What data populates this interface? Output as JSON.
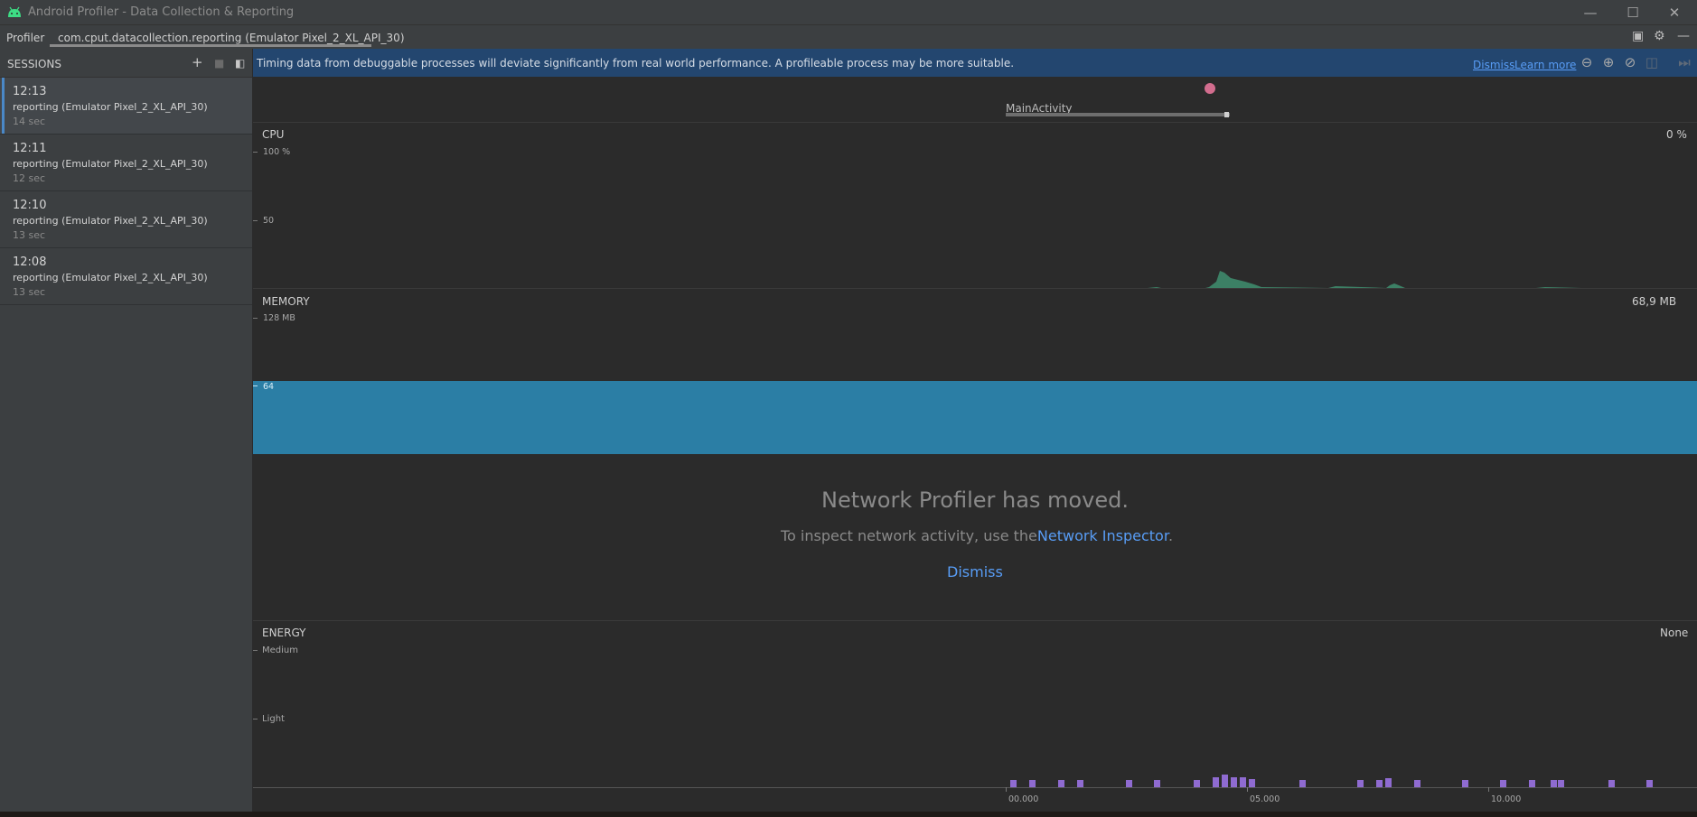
{
  "window": {
    "title": "Android Profiler - Data Collection & Reporting",
    "controls": [
      "—",
      "☐",
      "✕"
    ]
  },
  "tabs": [
    {
      "label": "Profiler"
    },
    {
      "label": "com.cput.datacollection.reporting (Emulator Pixel_2_XL_API_30)"
    }
  ],
  "sessions": {
    "title": "SESSIONS",
    "items": [
      {
        "time": "12:13",
        "name": "reporting (Emulator Pixel_2_XL_API_30)",
        "duration": "14 sec",
        "selected": true
      },
      {
        "time": "12:11",
        "name": "reporting (Emulator Pixel_2_XL_API_30)",
        "duration": "12 sec"
      },
      {
        "time": "12:10",
        "name": "reporting (Emulator Pixel_2_XL_API_30)",
        "duration": "13 sec"
      },
      {
        "time": "12:08",
        "name": "reporting (Emulator Pixel_2_XL_API_30)",
        "duration": "13 sec"
      }
    ]
  },
  "banner": {
    "text": "Timing data from debuggable processes will deviate significantly from real world performance. A profileable process may be more suitable.",
    "dismiss": "Dismiss",
    "learn_more": "Learn more"
  },
  "activity": {
    "label": "MainActivity"
  },
  "cpu": {
    "label": "CPU",
    "value": "0 %",
    "ticks": [
      "100 %",
      "50"
    ]
  },
  "memory": {
    "label": "MEMORY",
    "value": "68,9 MB",
    "ticks": [
      "128 MB",
      "64"
    ]
  },
  "network": {
    "title": "Network Profiler has moved.",
    "subtitle_prefix": "To inspect network activity, use the",
    "subtitle_link": "Network Inspector",
    "subtitle_suffix": ".",
    "dismiss": "Dismiss"
  },
  "energy": {
    "label": "ENERGY",
    "value": "None",
    "levels": [
      "Medium",
      "Light"
    ]
  },
  "timeline": {
    "labels": [
      "00.000",
      "05.000",
      "10.000"
    ]
  },
  "colors": {
    "cpu_fill": "#3e8a6b",
    "memory_fill": "#2b7ea5",
    "energy_bar": "#8f6bd1",
    "link": "#589df6",
    "banner_bg": "#23466f"
  }
}
